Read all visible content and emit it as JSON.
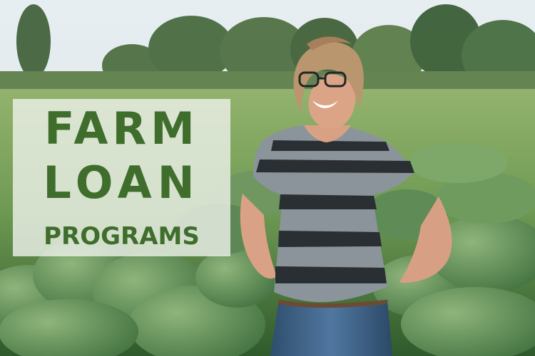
{
  "image": {
    "title_lines": [
      "FARM",
      "LOAN",
      "PROGRAMS"
    ],
    "subject": "smiling farmer with glasses in a striped shirt standing in a cabbage field",
    "colors": {
      "title_text": "#3f6e2c",
      "title_card": "#ecf0e8",
      "sky": "#dde8ee",
      "field": "#5d8a45",
      "shirt_dark": "#24292e",
      "shirt_light": "#8a949c",
      "jeans": "#3c5a78"
    }
  }
}
